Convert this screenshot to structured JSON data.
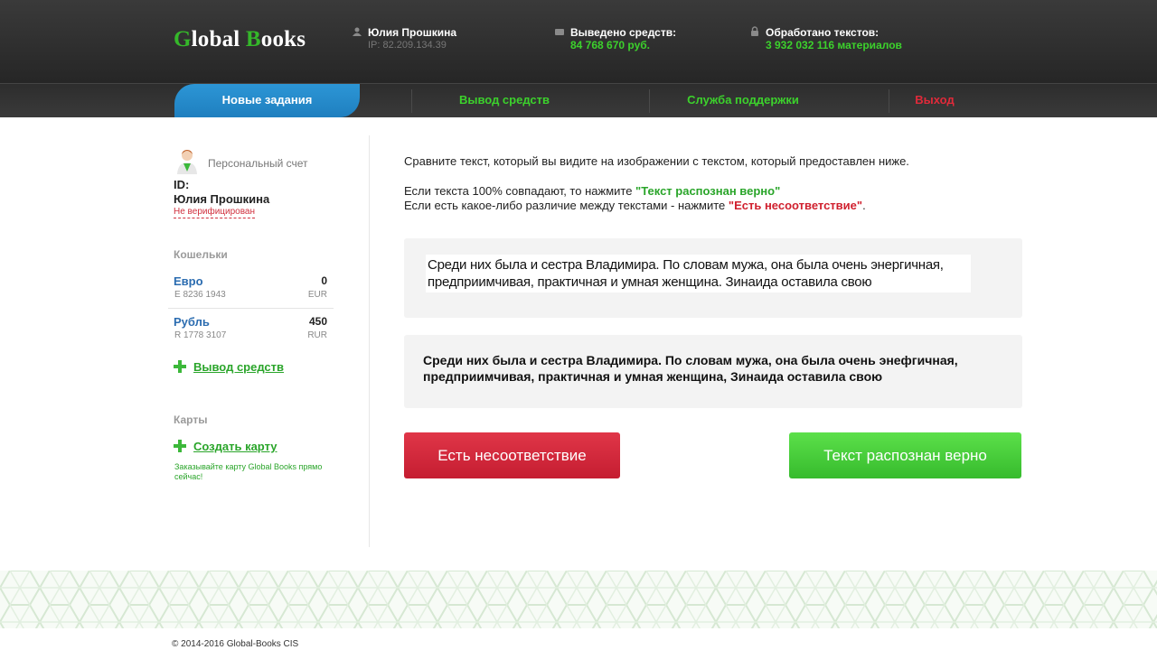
{
  "header": {
    "logo": {
      "part1_letter": "G",
      "part1_rest": "lobal ",
      "part2_letter": "B",
      "part2_rest": "ooks"
    },
    "user": {
      "icon": "user-icon",
      "name": "Юлия Прошкина",
      "ip": "IP: 82.209.134.39"
    },
    "withdrawn": {
      "icon": "wallet-icon",
      "label": "Выведено средств:",
      "value": "84 768 670 руб."
    },
    "processed": {
      "icon": "lock-icon",
      "label": "Обработано текстов:",
      "value": "3 932 032 116 материалов"
    }
  },
  "nav": {
    "items": [
      {
        "label": "Новые задания",
        "active": true
      },
      {
        "label": "Вывод средств"
      },
      {
        "label": "Служба поддержки"
      },
      {
        "label": "Выход"
      }
    ]
  },
  "sidebar": {
    "account_title": "Персональный счет",
    "id_label": "ID:",
    "user_name": "Юлия Прошкина",
    "verification_status": "Не верифицирован",
    "wallets_heading": "Кошельки",
    "wallets": [
      {
        "name": "Евро",
        "number": "E 8236 1943",
        "amount": "0",
        "currency": "EUR"
      },
      {
        "name": "Рубль",
        "number": "R 1778 3107",
        "amount": "450",
        "currency": "RUR"
      }
    ],
    "withdraw_link": "Вывод средств",
    "cards_heading": "Карты",
    "create_card_link": "Создать карту",
    "card_note": "Заказывайте карту Global Books прямо сейчас!"
  },
  "main": {
    "instruction": "Сравните текст, который вы видите на изображении с текстом, который предоставлен ниже.",
    "rule_match_prefix": "Если текста 100% совпадают, то нажмите ",
    "rule_match_button": "\"Текст распознан верно\"",
    "rule_mismatch_prefix": "Если есть какое-либо различие между текстами - нажмите ",
    "rule_mismatch_button": "\"Есть несоответствие\"",
    "rule_mismatch_suffix": ".",
    "scan_line1": "Среди них была и сестра Владимира. По словам мужа, она была очень энергичная,",
    "scan_line2": "предприимчивая, практичная и умная женщина. Зинаида оставила свою",
    "typed_line1": "Среди них была и сестра Владимира. По словам мужа, она была очень энефгичная,",
    "typed_line2": "предприимчивая, практичная и умная женщина, Зинаида оставила свою",
    "mismatch_button": "Есть несоответствие",
    "correct_button": "Текст распознан верно"
  },
  "footer": {
    "copyright": "© 2014-2016 Global-Books CIS"
  },
  "colors": {
    "brand_green": "#3cd12c",
    "accent_blue": "#1f7fbf",
    "danger_red": "#d0202e"
  }
}
